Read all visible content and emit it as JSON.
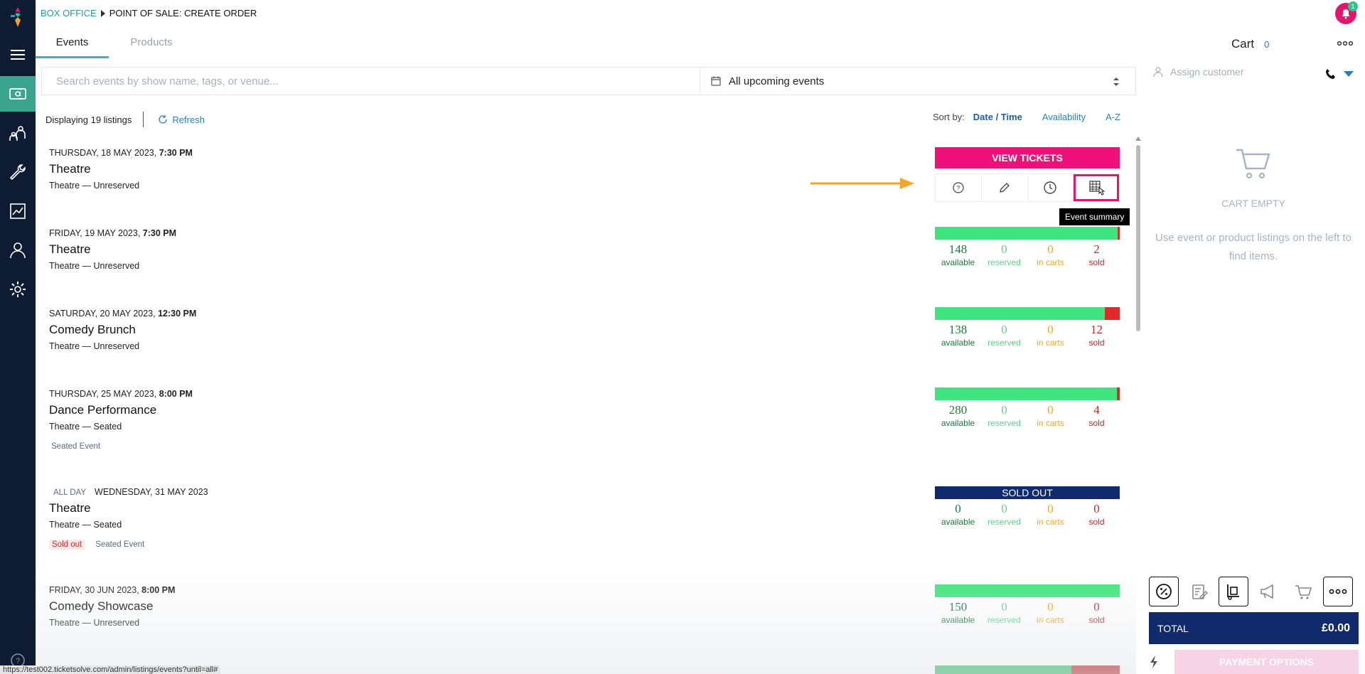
{
  "breadcrumb": {
    "root": "BOX OFFICE",
    "current": "POINT OF SALE: CREATE ORDER"
  },
  "notification_count": "1",
  "tabs": [
    {
      "label": "Events"
    },
    {
      "label": "Products"
    }
  ],
  "search": {
    "placeholder": "Search events by show name, tags, or venue...",
    "date_filter": "All upcoming events"
  },
  "listing": {
    "count_label": "Displaying 19 listings",
    "refresh_label": "Refresh"
  },
  "sort": {
    "label": "Sort by:",
    "options": [
      "Date / Time",
      "Availability",
      "A-Z"
    ],
    "active": "Date / Time"
  },
  "first_event": {
    "view_label": "VIEW TICKETS",
    "tooltip": "Event summary"
  },
  "stat_labels": {
    "available": "available",
    "reserved": "reserved",
    "in_carts": "in carts",
    "sold": "sold"
  },
  "events": [
    {
      "date": "THURSDAY, 18 MAY 2023,",
      "time": "7:30 PM",
      "title": "Theatre",
      "venue": "Theatre — Unreserved"
    },
    {
      "date": "FRIDAY, 19 MAY 2023,",
      "time": "7:30 PM",
      "title": "Theatre",
      "venue": "Theatre — Unreserved",
      "stats": {
        "available": "148",
        "reserved": "0",
        "in_carts": "0",
        "sold": "2"
      },
      "sold_fraction": 0.0133
    },
    {
      "date": "SATURDAY, 20 MAY 2023,",
      "time": "12:30 PM",
      "title": "Comedy Brunch",
      "venue": "Theatre — Unreserved",
      "stats": {
        "available": "138",
        "reserved": "0",
        "in_carts": "0",
        "sold": "12"
      },
      "sold_fraction": 0.08
    },
    {
      "date": "THURSDAY, 25 MAY 2023,",
      "time": "8:00 PM",
      "title": "Dance Performance",
      "venue": "Theatre — Seated",
      "tags": [
        "Seated Event"
      ],
      "stats": {
        "available": "280",
        "reserved": "0",
        "in_carts": "0",
        "sold": "4"
      },
      "sold_fraction": 0.014
    },
    {
      "allday": "All Day",
      "date": "WEDNESDAY, 31 MAY 2023",
      "title": "Theatre",
      "venue": "Theatre — Seated",
      "tag_soldout": "Sold out",
      "tags": [
        "Seated Event"
      ],
      "soldout_label": "SOLD OUT",
      "stats": {
        "available": "0",
        "reserved": "0",
        "in_carts": "0",
        "sold": "0"
      }
    },
    {
      "date": "FRIDAY, 30 JUN 2023,",
      "time": "8:00 PM",
      "title": "Comedy Showcase",
      "venue": "Theatre — Unreserved",
      "stats": {
        "available": "150",
        "reserved": "0",
        "in_carts": "0",
        "sold": "0"
      },
      "sold_fraction": 0
    }
  ],
  "status_url": "https://test002.ticketsolve.com/admin/listings/events?until=all#",
  "cart": {
    "title": "Cart",
    "count": "0",
    "assign_placeholder": "Assign customer",
    "empty_title": "CART EMPTY",
    "empty_desc": "Use event or product listings on the left to find items.",
    "total_label": "TOTAL",
    "total_value": "£0.00",
    "pay_label": "PAYMENT OPTIONS"
  },
  "colors": {
    "sidebar": "#0d1b33",
    "accent": "#3aa58f",
    "brand_pink": "#f0107a",
    "navy": "#102a6b",
    "available_bar": "#41e57f",
    "sold_bar": "#e02a2a"
  }
}
